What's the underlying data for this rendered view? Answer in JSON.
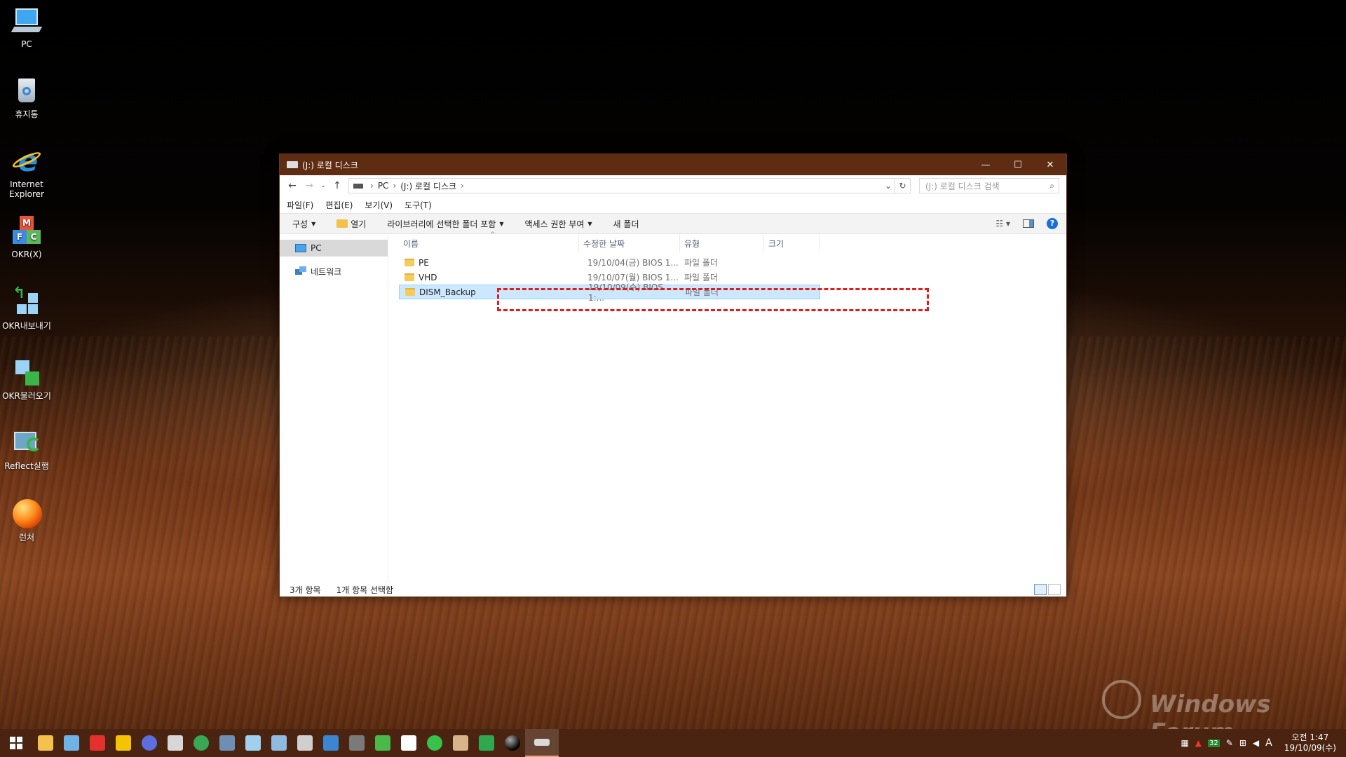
{
  "desktop": {
    "icons": [
      {
        "label": "PC",
        "icon": "computer-icon"
      },
      {
        "label": "휴지통",
        "icon": "recycle-bin-icon"
      },
      {
        "label": "Internet Explorer",
        "icon": "internet-explorer-icon"
      },
      {
        "label": "OKR(X)",
        "icon": "okr-icon"
      },
      {
        "label": "OKR내보내기",
        "icon": "okr-export-icon"
      },
      {
        "label": "OKR불러오기",
        "icon": "okr-import-icon"
      },
      {
        "label": "Reflect실행",
        "icon": "reflect-icon"
      },
      {
        "label": "런처",
        "icon": "launcher-icon"
      }
    ],
    "watermark": "Windows Forum"
  },
  "window": {
    "title": "(J:) 로컬 디스크",
    "controls": {
      "minimize": "—",
      "maximize": "☐",
      "close": "✕"
    },
    "address": {
      "crumbs": [
        "PC",
        "(J:) 로컬 디스크"
      ],
      "search_placeholder": "(J:) 로컬 디스크 검색"
    },
    "menu": [
      "파일(F)",
      "편집(E)",
      "보기(V)",
      "도구(T)"
    ],
    "commands": {
      "organize": "구성",
      "open": "열기",
      "include_library": "라이브러리에 선택한 폴더 포함",
      "share": "액세스 권한 부여",
      "new_folder": "새 폴더"
    },
    "nav": [
      {
        "label": "PC",
        "selected": true
      },
      {
        "label": "네트워크",
        "selected": false
      }
    ],
    "columns": {
      "name": "이름",
      "date": "수정한 날짜",
      "type": "유형",
      "size": "크기"
    },
    "files": [
      {
        "name": "PE",
        "date": "19/10/04(금) BIOS  1...",
        "type": "파일 폴더",
        "selected": false
      },
      {
        "name": "VHD",
        "date": "19/10/07(월) BIOS  1...",
        "type": "파일 폴더",
        "selected": false
      },
      {
        "name": "DISM_Backup",
        "date": "19/10/09(수) BIOS  1:...",
        "type": "파일 폴더",
        "selected": true
      }
    ],
    "status": {
      "count": "3개 항목",
      "selected": "1개 항목 선택함"
    }
  },
  "taskbar": {
    "tray": {
      "badge": "32",
      "ime": "A"
    },
    "clock": {
      "time": "오전 1:47",
      "date": "19/10/09(수)"
    }
  }
}
